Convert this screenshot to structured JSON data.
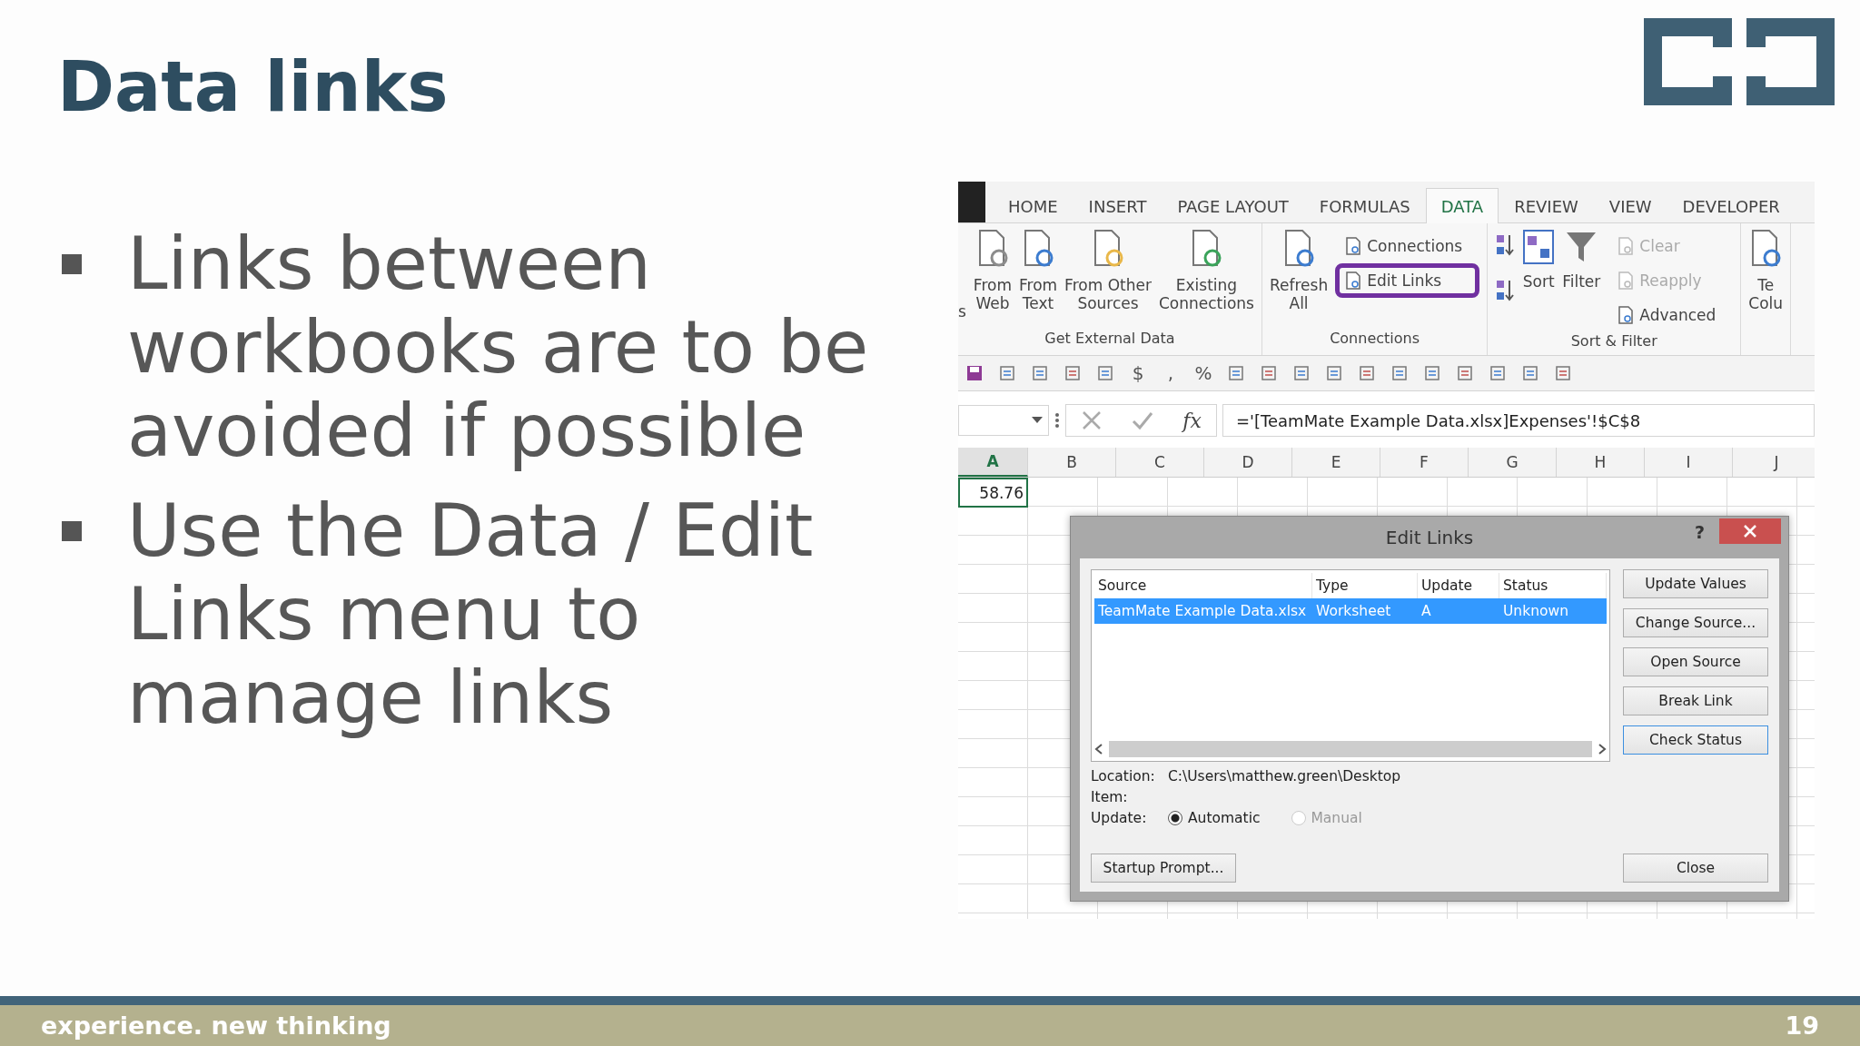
{
  "slide": {
    "title": "Data links",
    "bullets": [
      "Links between workbooks are to be avoided if possible",
      "Use the Data / Edit Links menu to manage links"
    ]
  },
  "excel": {
    "tabs": [
      {
        "label": "HOME",
        "selected": false
      },
      {
        "label": "INSERT",
        "selected": false
      },
      {
        "label": "PAGE LAYOUT",
        "selected": false
      },
      {
        "label": "FORMULAS",
        "selected": false
      },
      {
        "label": "DATA",
        "selected": true
      },
      {
        "label": "REVIEW",
        "selected": false
      },
      {
        "label": "VIEW",
        "selected": false
      },
      {
        "label": "DEVELOPER",
        "selected": false
      }
    ],
    "groups": [
      {
        "label": "Get External Data",
        "items": [
          {
            "kind": "edge",
            "lines": [
              "s"
            ]
          },
          {
            "kind": "large",
            "lines": [
              "From",
              "Web"
            ]
          },
          {
            "kind": "large",
            "lines": [
              "From",
              "Text"
            ]
          },
          {
            "kind": "large",
            "lines": [
              "From Other",
              "Sources"
            ]
          },
          {
            "kind": "large",
            "lines": [
              "Existing",
              "Connections"
            ]
          }
        ]
      },
      {
        "label": "Connections",
        "items": [
          {
            "kind": "large",
            "lines": [
              "Refresh",
              "All"
            ]
          },
          {
            "kind": "stack",
            "entries": [
              {
                "label": "Connections",
                "disabled": false,
                "highlighted": false
              },
              {
                "label": "Edit Links",
                "disabled": false,
                "highlighted": true
              }
            ]
          }
        ]
      },
      {
        "label": "Sort & Filter",
        "items": [
          {
            "kind": "sort-pair"
          },
          {
            "kind": "sort-large",
            "lines": [
              "Sort"
            ]
          },
          {
            "kind": "filter",
            "lines": [
              "Filter"
            ]
          },
          {
            "kind": "stack",
            "entries": [
              {
                "label": "Clear",
                "disabled": true,
                "highlighted": false
              },
              {
                "label": "Reapply",
                "disabled": true,
                "highlighted": false
              },
              {
                "label": "Advanced",
                "disabled": false,
                "highlighted": false
              }
            ]
          }
        ]
      },
      {
        "items": [
          {
            "kind": "large",
            "lines": [
              "Te",
              "Colu"
            ]
          }
        ]
      }
    ],
    "toolbar": [
      {
        "kind": "icon"
      },
      {
        "kind": "icon"
      },
      {
        "kind": "icon"
      },
      {
        "kind": "icon"
      },
      {
        "kind": "icon"
      },
      {
        "kind": "glyph",
        "text": "$"
      },
      {
        "kind": "glyph",
        "text": ","
      },
      {
        "kind": "glyph",
        "text": "%"
      },
      {
        "kind": "icon"
      },
      {
        "kind": "icon"
      },
      {
        "kind": "icon"
      },
      {
        "kind": "icon"
      },
      {
        "kind": "icon"
      },
      {
        "kind": "icon"
      },
      {
        "kind": "icon"
      },
      {
        "kind": "icon"
      },
      {
        "kind": "icon"
      },
      {
        "kind": "icon"
      },
      {
        "kind": "icon"
      }
    ],
    "formula_bar": {
      "fx": "fx",
      "formula": "='[TeamMate Example Data.xlsx]Expenses'!$C$8"
    },
    "columns": [
      {
        "label": "A",
        "selected": true
      },
      {
        "label": "B",
        "selected": false
      },
      {
        "label": "C",
        "selected": false
      },
      {
        "label": "D",
        "selected": false
      },
      {
        "label": "E",
        "selected": false
      },
      {
        "label": "F",
        "selected": false
      },
      {
        "label": "G",
        "selected": false
      },
      {
        "label": "H",
        "selected": false
      },
      {
        "label": "I",
        "selected": false
      },
      {
        "label": "J",
        "selected": false
      }
    ],
    "cell_a1": "58.76",
    "dialog": {
      "title": "Edit Links",
      "help": "?",
      "columns": [
        "Source",
        "Type",
        "Update",
        "Status"
      ],
      "rows": [
        {
          "cells": [
            "TeamMate Example Data.xlsx",
            "Worksheet",
            "A",
            "Unknown"
          ],
          "selected": true
        }
      ],
      "buttons": [
        {
          "label": "Update Values",
          "focused": false
        },
        {
          "label": "Change Source...",
          "focused": false
        },
        {
          "label": "Open Source",
          "focused": false
        },
        {
          "label": "Break Link",
          "focused": false
        },
        {
          "label": "Check Status",
          "focused": true
        }
      ],
      "location_label": "Location:",
      "location": "C:\\Users\\matthew.green\\Desktop",
      "item_label": "Item:",
      "update_label": "Update:",
      "update_options": [
        {
          "label": "Automatic",
          "selected": true,
          "disabled": false
        },
        {
          "label": "Manual",
          "selected": false,
          "disabled": true
        }
      ],
      "startup_button": "Startup Prompt...",
      "close_button": "Close"
    }
  },
  "footer": {
    "tagline": "experience. new thinking",
    "page": "19"
  }
}
